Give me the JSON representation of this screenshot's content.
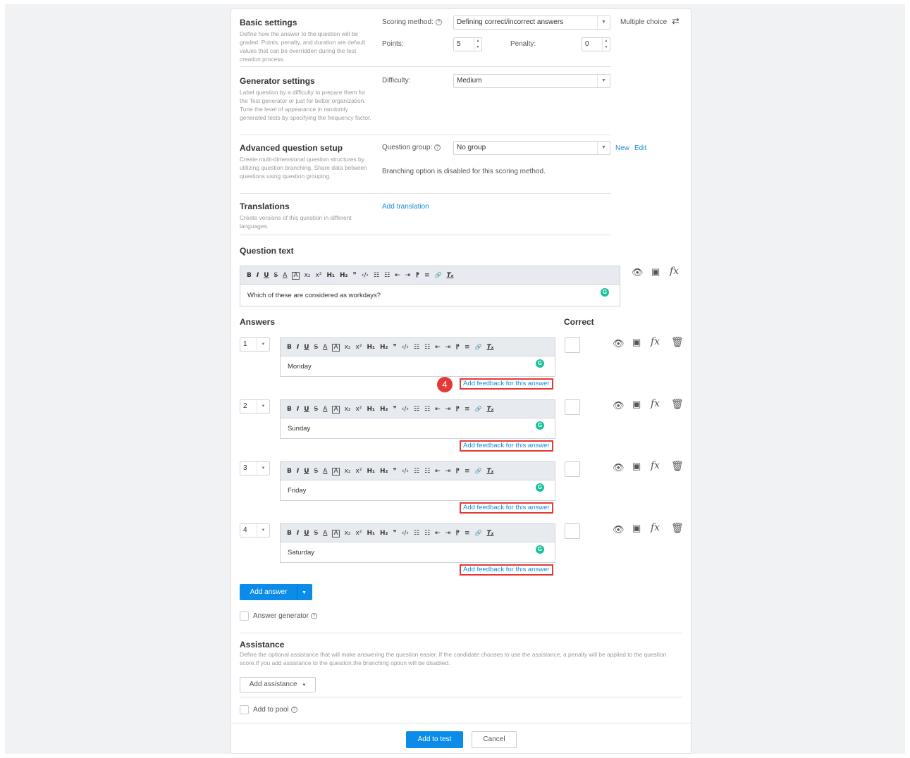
{
  "basic_settings": {
    "title": "Basic settings",
    "description": "Define how the answer to the question will be graded. Points, penalty, and duration are default values that can be overridden during the test creation process.",
    "scoring_label": "Scoring method:",
    "scoring_value": "Defining correct/incorrect answers",
    "question_type": "Multiple choice",
    "points_label": "Points:",
    "points_value": "5",
    "penalty_label": "Penalty:",
    "penalty_value": "0"
  },
  "generator_settings": {
    "title": "Generator settings",
    "description": "Label question by a difficulty to prepare them for the Test generator or just for better organization. Tune the level of appearance in randomly generated tests by specifying the frequency factor.",
    "difficulty_label": "Difficulty:",
    "difficulty_value": "Medium"
  },
  "advanced_setup": {
    "title": "Advanced question setup",
    "description": "Create multi-dimensional question structures by utilizing question branching. Share data between questions using question grouping.",
    "group_label": "Question group:",
    "group_value": "No group",
    "new_label": "New",
    "edit_label": "Edit",
    "branching_note": "Branching option is disabled for this scoring method."
  },
  "translations": {
    "title": "Translations",
    "description": "Create versions of this question in different languages.",
    "add_label": "Add translation"
  },
  "question_text": {
    "title": "Question text",
    "value": "Which of these are considered as workdays?"
  },
  "toolbar_buttons": [
    "B",
    "I",
    "U",
    "S",
    "A",
    "A",
    "x₂",
    "x²",
    "H₁",
    "H₂",
    "❞",
    "‹/›",
    "☷",
    "☷",
    "⇤",
    "⇥",
    "⁋",
    "≡",
    "🔗",
    "Tₓ"
  ],
  "answers": {
    "title": "Answers",
    "correct_title": "Correct",
    "feedback_label": "Add feedback for this answer",
    "badge": "4",
    "items": [
      {
        "number": "1",
        "text": "Monday"
      },
      {
        "number": "2",
        "text": "Sunday"
      },
      {
        "number": "3",
        "text": "Friday"
      },
      {
        "number": "4",
        "text": "Saturday"
      }
    ],
    "add_answer_label": "Add answer",
    "generator_label": "Answer generator"
  },
  "assistance": {
    "title": "Assistance",
    "description": "Define the optional assistance that will make answering the question easier. If the candidate chooses to use the assistance, a penalty will be applied to the question score.If you add assistance to the question,the branching option will be disabled.",
    "add_label": "Add assistance"
  },
  "pool": {
    "label": "Add to pool"
  },
  "footer": {
    "add_to_test": "Add to test",
    "cancel": "Cancel"
  },
  "grammarly_glyph": "G",
  "colors": {
    "accent": "#0a8ce8",
    "highlight": "#e53935",
    "grammarly": "#15c39a"
  }
}
